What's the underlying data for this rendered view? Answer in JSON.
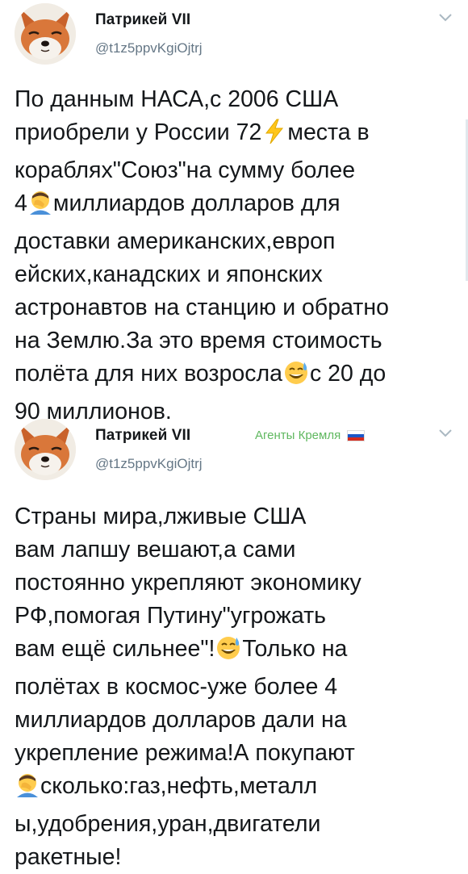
{
  "tweets": [
    {
      "author": {
        "name": "Патрикей VII",
        "handle": "@t1z5ppvKgiOjtrj",
        "avatar_icon": "fox-face-icon"
      },
      "menu_icon": "chevron-down-icon",
      "lines": [
        [
          "По данным НАСА,с 2006 США"
        ],
        [
          "приобрели у России 72",
          "⚡",
          "места в"
        ],
        [
          "кораблях\"Союз\"на сумму более"
        ],
        [
          "4",
          "🤦",
          "миллиардов долларов для"
        ],
        [
          "доставки американских,европ"
        ],
        [
          "ейских,канадских и японских"
        ],
        [
          "астронавтов на станцию и обратно"
        ],
        [
          "на Землю.За это время стоимость"
        ],
        [
          "полёта для них возросла",
          "😅",
          "с 20 до"
        ],
        [
          "90 миллионов."
        ]
      ]
    },
    {
      "author": {
        "name": "Патрикей VII",
        "handle": "@t1z5ppvKgiOjtrj",
        "avatar_icon": "fox-face-icon"
      },
      "badge": {
        "text": "Агенты Кремля",
        "icon": "russian-flag-icon",
        "color": "#5fb85f"
      },
      "menu_icon": "chevron-down-icon",
      "lines": [
        [
          "Страны мира,лживые США"
        ],
        [
          "вам лапшу вешают,а сами"
        ],
        [
          "постоянно укрепляют экономику"
        ],
        [
          "РФ,помогая Путину\"угрожать"
        ],
        [
          "вам ещё сильнее\"!",
          "😅",
          "Только на"
        ],
        [
          "полётах в космос-уже более 4"
        ],
        [
          "миллиардов долларов дали на"
        ],
        [
          "укрепление режима!А покупают"
        ],
        [
          "🤦",
          "сколько:газ,нефть,металл"
        ],
        [
          "ы,удобрения,уран,двигатели"
        ],
        [
          "ракетные!"
        ]
      ]
    }
  ],
  "colors": {
    "text": "#14171a",
    "secondary": "#657786",
    "badge_green": "#5fb85f"
  }
}
